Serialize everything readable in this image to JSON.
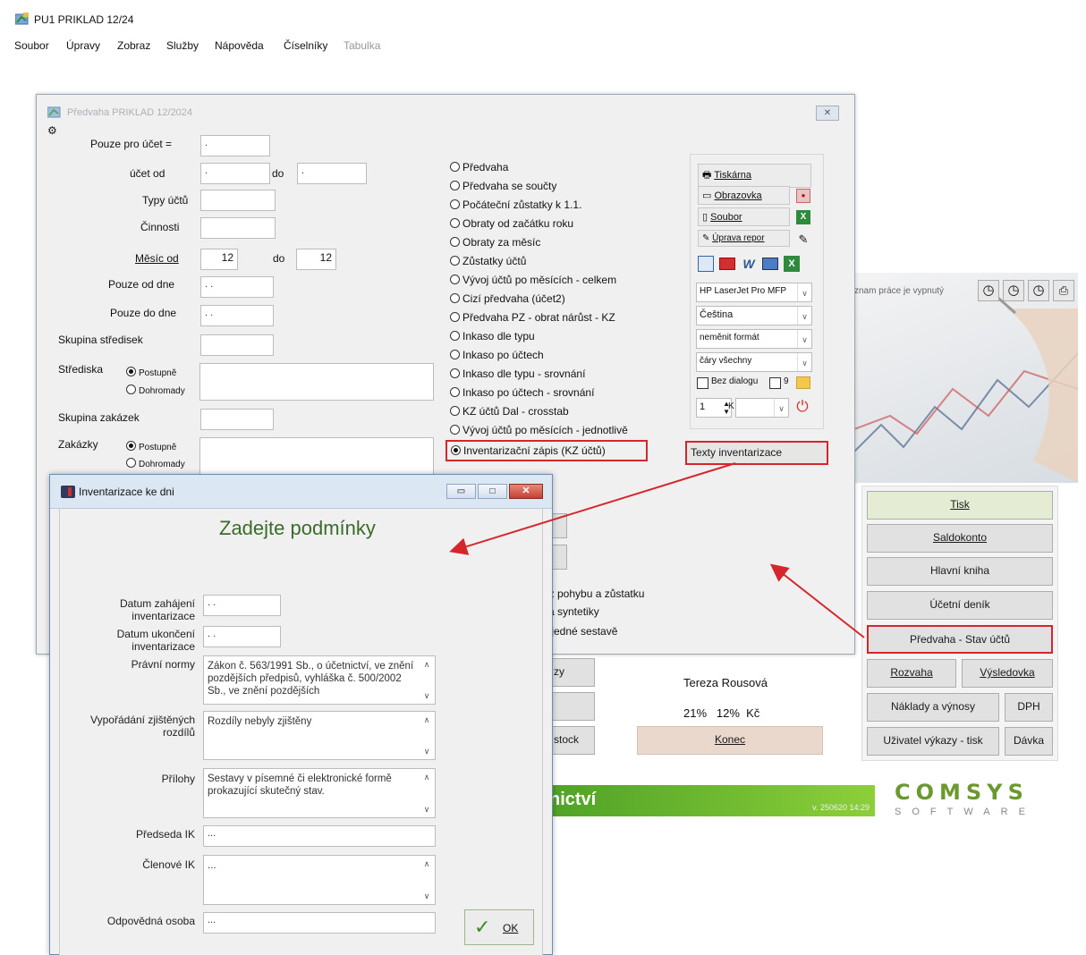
{
  "app": {
    "title": "PU1 PRIKLAD 12/24",
    "menu": [
      "Soubor",
      "Úpravy",
      "Zobraz",
      "Služby",
      "Nápověda",
      "Číselníky",
      "Tabulka"
    ]
  },
  "main_panel": {
    "status_text": "znam práce je vypnutý",
    "nav_buttons": [
      "Tisk",
      "Saldokonto",
      "Hlavní kniha",
      "Účetní deník",
      "Předvaha - Stav účtů",
      "Rozvaha",
      "Výsledovka",
      "Náklady a výnosy",
      "DPH",
      "Uživatel výkazy - tisk",
      "Dávka"
    ],
    "user_name": "Tereza Rousová",
    "vat_rates": "21%   12%  Kč",
    "end_button": "Konec",
    "partial_buttons": [
      "zy",
      "stock"
    ],
    "banner_text": "nictví",
    "version": "v. 250620 14:29",
    "brand": "COMSYS",
    "brand_sub": "SOFTWARE",
    "behind_text": [
      "ez pohybu a zůstatku",
      "za syntetiky",
      "v jedné sestavě"
    ]
  },
  "predvaha": {
    "title": "Předvaha PRIKLAD 12/2024",
    "labels": {
      "pouze_ucet": "Pouze pro  účet =",
      "ucet_od": "účet od",
      "do": "do",
      "typy_uctu": "Typy účtů",
      "cinnosti": "Činnosti",
      "mesic_od": "Měsíc od",
      "pouze_od_dne": "Pouze od dne",
      "pouze_do_dne": "Pouze do dne",
      "skupina_stredisek": "Skupina středisek",
      "strediska": "Střediska",
      "skupina_zakazek": "Skupina zakázek",
      "zakazky": "Zakázky",
      "postupne": "Postupně",
      "dohromady": "Dohromady"
    },
    "values": {
      "pouze_ucet": "  .",
      "ucet_od": "  .",
      "ucet_do": "  .",
      "mesic_od": "12",
      "mesic_do": "12",
      "od_dne": " . .",
      "do_dne": " . ."
    },
    "report_options": [
      "Předvaha",
      "Předvaha se součty",
      "Počáteční zůstatky k 1.1.",
      "Obraty od začátku roku",
      "Obraty za měsíc",
      "Zůstatky účtů",
      "Vývoj účtů po měsících - celkem",
      "Cizí předvaha (účet2)",
      "Předvaha PZ - obrat nárůst - KZ",
      "Inkaso dle typu",
      "Inkaso po účtech",
      "Inkaso dle typu - srovnání",
      "Inkaso po účtech - srovnání",
      "KZ účtů Dal - crosstab",
      "Vývoj účtů po měsících - jednotlivě",
      "Inventarizační zápis (KZ účtů)"
    ],
    "selected_option": 15,
    "output": {
      "tiskarna": "Tiskárna",
      "obrazovka": "Obrazovka",
      "soubor": "Soubor",
      "uprava": "Úprava repor",
      "printer": "HP LaserJet Pro MFP",
      "language": "Čeština",
      "format": "neměnit formát",
      "lines": "čáry všechny",
      "bez_dialogu": "Bez dialogu",
      "nine": "9",
      "copies": "1",
      "k": "K"
    },
    "texty_button": "Texty inventarizace"
  },
  "inventarizace": {
    "title": "Inventarizace ke dni",
    "heading": "Zadejte podmínky",
    "labels": {
      "datum_zahajeni": "Datum zahájení\ninventarizace",
      "datum_ukonceni": "Datum ukončení\ninventarizace",
      "pravni_normy": "Právní normy",
      "vyporadani": "Vypořádání zjištěných\nrozdílů",
      "prilohy": "Přílohy",
      "predseda": "Předseda IK",
      "clenove": "Členové IK",
      "odpovedna": "Odpovědná osoba"
    },
    "values": {
      "datum_zahajeni": " . .",
      "datum_ukonceni": " . .",
      "pravni_normy": "Zákon č. 563/1991 Sb., o účetnictví, ve znění pozdějších předpisů, vyhláška č. 500/2002 Sb., ve znění pozdějších",
      "vyporadani": "Rozdíly nebyly zjištěny",
      "prilohy": "Sestavy v písemné či elektronické formě prokazující skutečný stav.",
      "predseda": "...",
      "clenove": "...",
      "odpovedna": "..."
    },
    "ok_label": "OK"
  }
}
